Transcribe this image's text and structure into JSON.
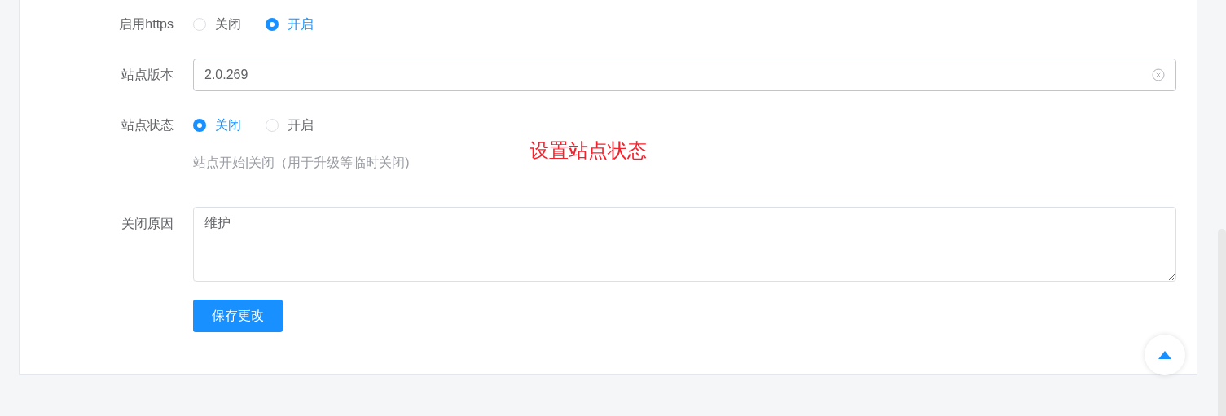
{
  "form": {
    "https": {
      "label": "启用https",
      "options": [
        {
          "label": "关闭",
          "selected": false
        },
        {
          "label": "开启",
          "selected": true
        }
      ]
    },
    "version": {
      "label": "站点版本",
      "value": "2.0.269"
    },
    "status": {
      "label": "站点状态",
      "options": [
        {
          "label": "关闭",
          "selected": true
        },
        {
          "label": "开启",
          "selected": false
        }
      ],
      "help": "站点开始|关闭（用于升级等临时关闭)"
    },
    "reason": {
      "label": "关闭原因",
      "value": "维护"
    },
    "save_button": "保存更改"
  },
  "annotation": "设置站点状态"
}
